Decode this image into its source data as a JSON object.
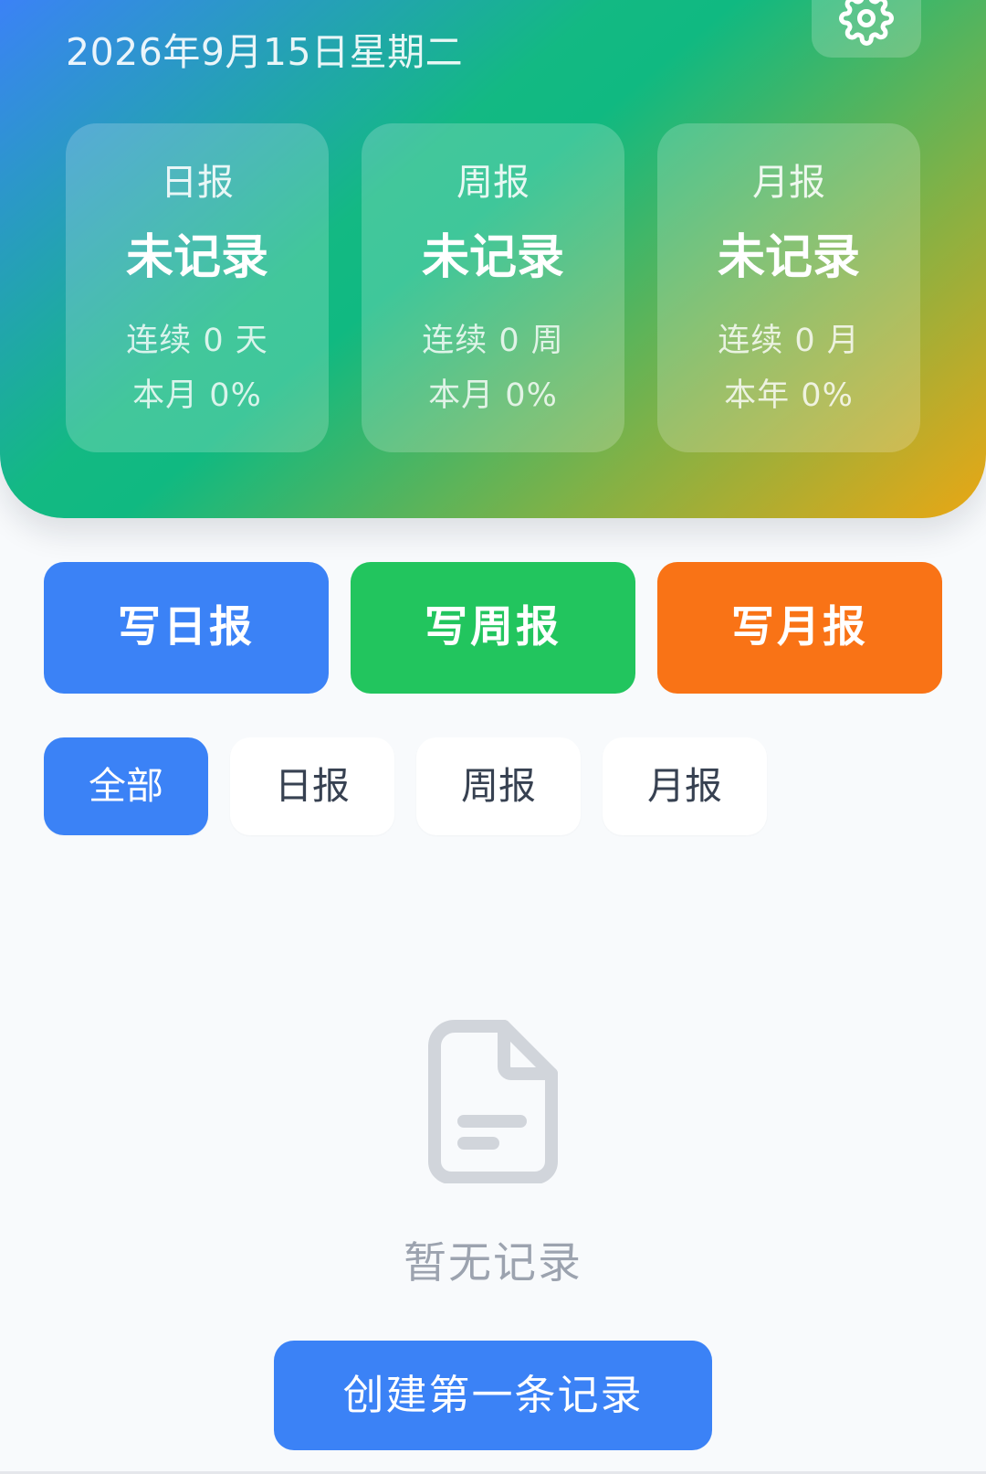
{
  "header": {
    "date": "2026年9月15日星期二",
    "settings_icon": "gear-icon"
  },
  "stats": [
    {
      "title": "日报",
      "status": "未记录",
      "streak": "连续 0 天",
      "rate": "本月 0%"
    },
    {
      "title": "周报",
      "status": "未记录",
      "streak": "连续 0 周",
      "rate": "本月 0%"
    },
    {
      "title": "月报",
      "status": "未记录",
      "streak": "连续 0 月",
      "rate": "本年 0%"
    }
  ],
  "actions": {
    "write_daily": "写日报",
    "write_weekly": "写周报",
    "write_monthly": "写月报"
  },
  "filters": {
    "items": [
      "全部",
      "日报",
      "周报",
      "月报"
    ],
    "active": "全部"
  },
  "empty": {
    "icon": "document-icon",
    "text": "暂无记录",
    "create_label": "创建第一条记录"
  },
  "colors": {
    "primary": "#3b82f6",
    "green": "#22c55e",
    "orange": "#f97316",
    "empty_text": "#9ca3af"
  }
}
